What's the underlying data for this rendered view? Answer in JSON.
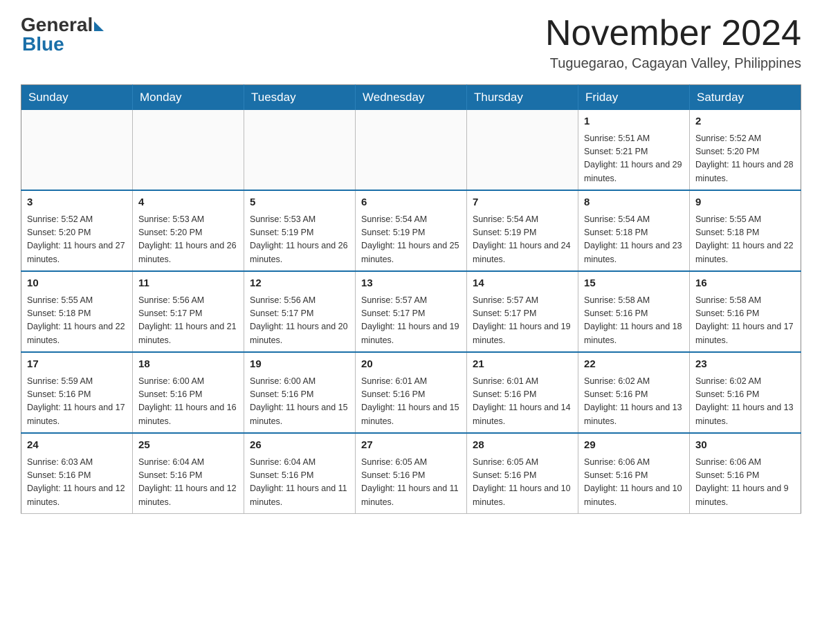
{
  "header": {
    "logo_general": "General",
    "logo_blue": "Blue",
    "month_title": "November 2024",
    "location": "Tuguegarao, Cagayan Valley, Philippines"
  },
  "weekdays": [
    "Sunday",
    "Monday",
    "Tuesday",
    "Wednesday",
    "Thursday",
    "Friday",
    "Saturday"
  ],
  "weeks": [
    [
      {
        "day": "",
        "info": ""
      },
      {
        "day": "",
        "info": ""
      },
      {
        "day": "",
        "info": ""
      },
      {
        "day": "",
        "info": ""
      },
      {
        "day": "",
        "info": ""
      },
      {
        "day": "1",
        "info": "Sunrise: 5:51 AM\nSunset: 5:21 PM\nDaylight: 11 hours and 29 minutes."
      },
      {
        "day": "2",
        "info": "Sunrise: 5:52 AM\nSunset: 5:20 PM\nDaylight: 11 hours and 28 minutes."
      }
    ],
    [
      {
        "day": "3",
        "info": "Sunrise: 5:52 AM\nSunset: 5:20 PM\nDaylight: 11 hours and 27 minutes."
      },
      {
        "day": "4",
        "info": "Sunrise: 5:53 AM\nSunset: 5:20 PM\nDaylight: 11 hours and 26 minutes."
      },
      {
        "day": "5",
        "info": "Sunrise: 5:53 AM\nSunset: 5:19 PM\nDaylight: 11 hours and 26 minutes."
      },
      {
        "day": "6",
        "info": "Sunrise: 5:54 AM\nSunset: 5:19 PM\nDaylight: 11 hours and 25 minutes."
      },
      {
        "day": "7",
        "info": "Sunrise: 5:54 AM\nSunset: 5:19 PM\nDaylight: 11 hours and 24 minutes."
      },
      {
        "day": "8",
        "info": "Sunrise: 5:54 AM\nSunset: 5:18 PM\nDaylight: 11 hours and 23 minutes."
      },
      {
        "day": "9",
        "info": "Sunrise: 5:55 AM\nSunset: 5:18 PM\nDaylight: 11 hours and 22 minutes."
      }
    ],
    [
      {
        "day": "10",
        "info": "Sunrise: 5:55 AM\nSunset: 5:18 PM\nDaylight: 11 hours and 22 minutes."
      },
      {
        "day": "11",
        "info": "Sunrise: 5:56 AM\nSunset: 5:17 PM\nDaylight: 11 hours and 21 minutes."
      },
      {
        "day": "12",
        "info": "Sunrise: 5:56 AM\nSunset: 5:17 PM\nDaylight: 11 hours and 20 minutes."
      },
      {
        "day": "13",
        "info": "Sunrise: 5:57 AM\nSunset: 5:17 PM\nDaylight: 11 hours and 19 minutes."
      },
      {
        "day": "14",
        "info": "Sunrise: 5:57 AM\nSunset: 5:17 PM\nDaylight: 11 hours and 19 minutes."
      },
      {
        "day": "15",
        "info": "Sunrise: 5:58 AM\nSunset: 5:16 PM\nDaylight: 11 hours and 18 minutes."
      },
      {
        "day": "16",
        "info": "Sunrise: 5:58 AM\nSunset: 5:16 PM\nDaylight: 11 hours and 17 minutes."
      }
    ],
    [
      {
        "day": "17",
        "info": "Sunrise: 5:59 AM\nSunset: 5:16 PM\nDaylight: 11 hours and 17 minutes."
      },
      {
        "day": "18",
        "info": "Sunrise: 6:00 AM\nSunset: 5:16 PM\nDaylight: 11 hours and 16 minutes."
      },
      {
        "day": "19",
        "info": "Sunrise: 6:00 AM\nSunset: 5:16 PM\nDaylight: 11 hours and 15 minutes."
      },
      {
        "day": "20",
        "info": "Sunrise: 6:01 AM\nSunset: 5:16 PM\nDaylight: 11 hours and 15 minutes."
      },
      {
        "day": "21",
        "info": "Sunrise: 6:01 AM\nSunset: 5:16 PM\nDaylight: 11 hours and 14 minutes."
      },
      {
        "day": "22",
        "info": "Sunrise: 6:02 AM\nSunset: 5:16 PM\nDaylight: 11 hours and 13 minutes."
      },
      {
        "day": "23",
        "info": "Sunrise: 6:02 AM\nSunset: 5:16 PM\nDaylight: 11 hours and 13 minutes."
      }
    ],
    [
      {
        "day": "24",
        "info": "Sunrise: 6:03 AM\nSunset: 5:16 PM\nDaylight: 11 hours and 12 minutes."
      },
      {
        "day": "25",
        "info": "Sunrise: 6:04 AM\nSunset: 5:16 PM\nDaylight: 11 hours and 12 minutes."
      },
      {
        "day": "26",
        "info": "Sunrise: 6:04 AM\nSunset: 5:16 PM\nDaylight: 11 hours and 11 minutes."
      },
      {
        "day": "27",
        "info": "Sunrise: 6:05 AM\nSunset: 5:16 PM\nDaylight: 11 hours and 11 minutes."
      },
      {
        "day": "28",
        "info": "Sunrise: 6:05 AM\nSunset: 5:16 PM\nDaylight: 11 hours and 10 minutes."
      },
      {
        "day": "29",
        "info": "Sunrise: 6:06 AM\nSunset: 5:16 PM\nDaylight: 11 hours and 10 minutes."
      },
      {
        "day": "30",
        "info": "Sunrise: 6:06 AM\nSunset: 5:16 PM\nDaylight: 11 hours and 9 minutes."
      }
    ]
  ]
}
